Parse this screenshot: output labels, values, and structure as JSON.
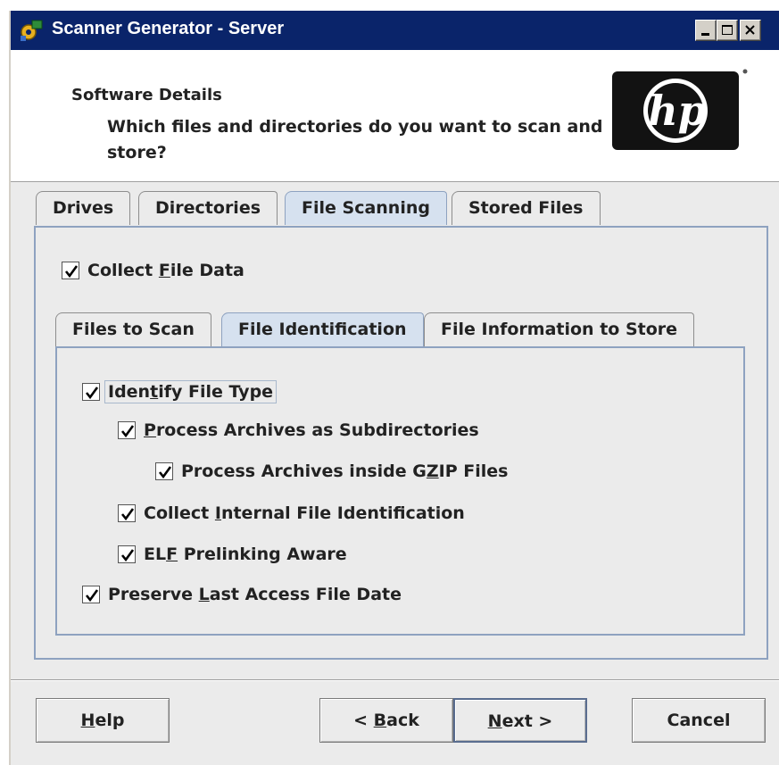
{
  "window": {
    "title": "Scanner Generator - Server",
    "icon": "app-gear-icon",
    "controls": [
      "minimize-icon",
      "maximize-icon",
      "close-icon"
    ]
  },
  "header": {
    "section": "Software Details",
    "question": "Which files and directories do you want to scan and store?",
    "logo": "hp"
  },
  "outer_tabs": [
    {
      "label": "Drives",
      "active": false
    },
    {
      "label": "Directories",
      "active": false
    },
    {
      "label": "File Scanning",
      "active": true
    },
    {
      "label": "Stored Files",
      "active": false
    }
  ],
  "collect_file_data": {
    "pre": "Collect ",
    "mnemonic": "F",
    "post": "ile Data",
    "checked": true
  },
  "inner_tabs": [
    {
      "label": "Files to Scan",
      "active": false
    },
    {
      "label": "File Identification",
      "active": true
    },
    {
      "label": "File Information to Store",
      "active": false
    }
  ],
  "options": {
    "identify_file_type": {
      "pre": "Iden",
      "mnemonic": "t",
      "post": "ify File Type",
      "checked": true
    },
    "process_archives": {
      "pre": "",
      "mnemonic": "P",
      "post": "rocess Archives as Subdirectories",
      "checked": true
    },
    "process_gzip": {
      "pre": "Process Archives inside G",
      "mnemonic": "Z",
      "post": "IP Files",
      "checked": true
    },
    "collect_internal": {
      "pre": "Collect ",
      "mnemonic": "I",
      "post": "nternal File Identification",
      "checked": true
    },
    "elf_prelinking": {
      "pre": "EL",
      "mnemonic": "F",
      "post": " Prelinking Aware",
      "checked": true
    },
    "preserve_last_access": {
      "pre": "Preserve ",
      "mnemonic": "L",
      "post": "ast Access File Date",
      "checked": true
    }
  },
  "buttons": {
    "help": {
      "pre": "",
      "mnemonic": "H",
      "post": "elp"
    },
    "back": {
      "pre": "< ",
      "mnemonic": "B",
      "post": "ack"
    },
    "next": {
      "pre": "",
      "mnemonic": "N",
      "post": "ext >"
    },
    "cancel": {
      "label": "Cancel"
    }
  }
}
